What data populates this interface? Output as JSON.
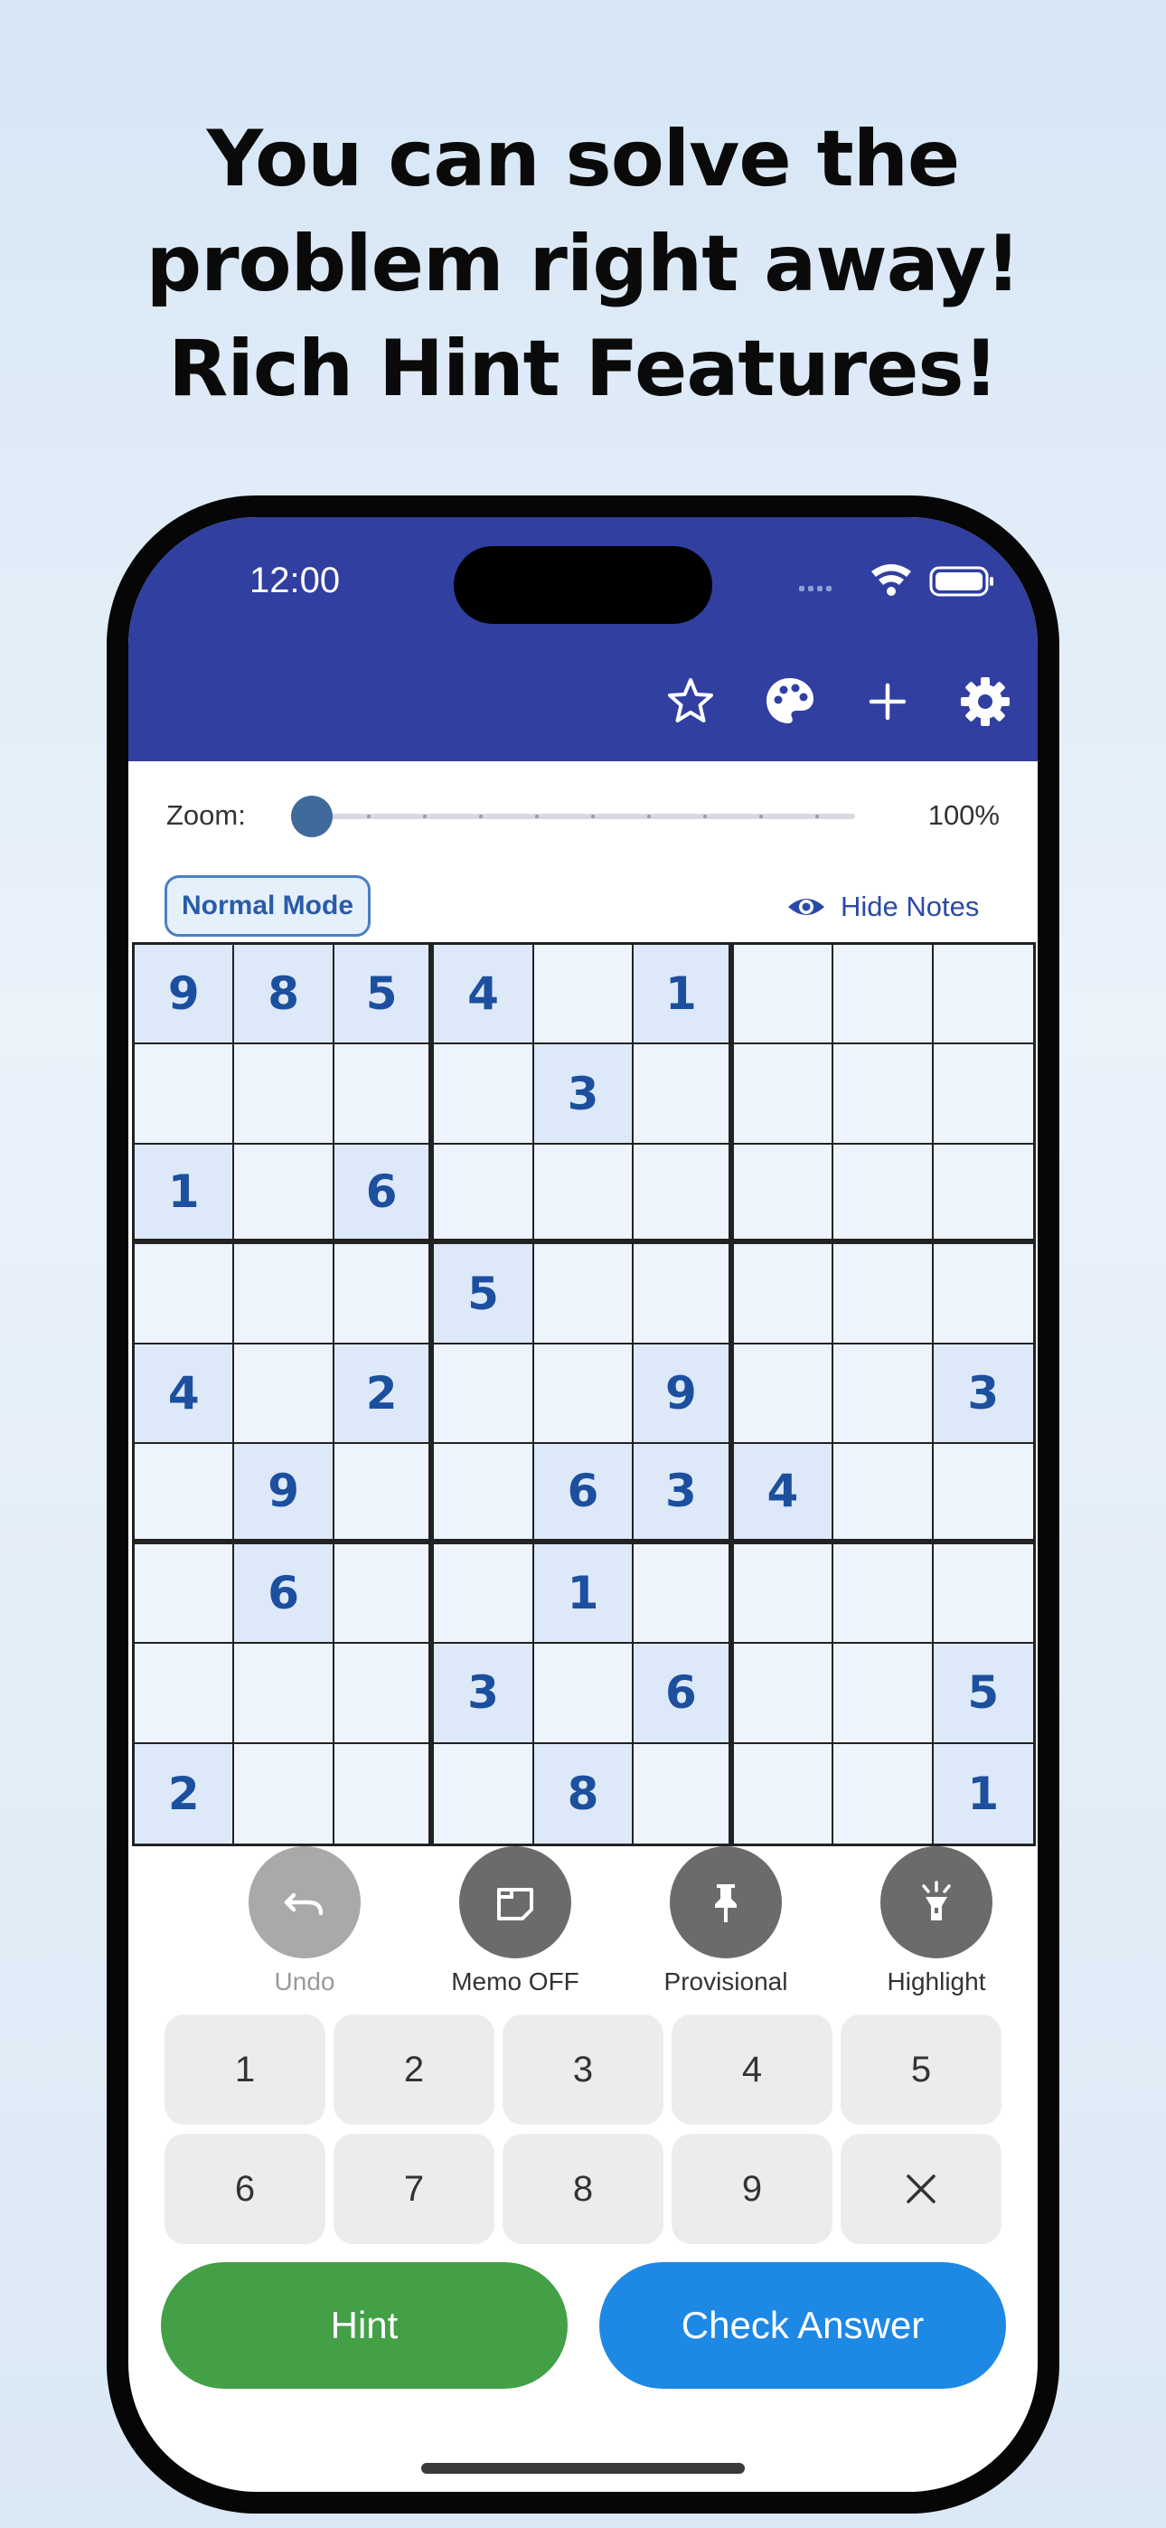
{
  "headline": {
    "line1": "You can solve the",
    "line2": "problem right away!",
    "line3": "Rich Hint Features!"
  },
  "status_bar": {
    "time": "12:00"
  },
  "toolbar": {
    "icons": [
      "star-outline-icon",
      "palette-icon",
      "plus-icon",
      "gear-icon"
    ]
  },
  "zoom": {
    "label": "Zoom:",
    "value_text": "100%",
    "level": 0.0
  },
  "mode": {
    "label": "Normal Mode"
  },
  "notes_toggle": {
    "label": "Hide Notes",
    "icon": "eye-icon"
  },
  "board": {
    "rows": [
      [
        "9",
        "8",
        "5",
        "4",
        "",
        "1",
        "",
        "",
        ""
      ],
      [
        "",
        "",
        "",
        "",
        "3",
        "",
        "",
        "",
        ""
      ],
      [
        "1",
        "",
        "6",
        "",
        "",
        "",
        "",
        "",
        ""
      ],
      [
        "",
        "",
        "",
        "5",
        "",
        "",
        "",
        "",
        ""
      ],
      [
        "4",
        "",
        "2",
        "",
        "",
        "9",
        "",
        "",
        "3"
      ],
      [
        "",
        "9",
        "",
        "",
        "6",
        "3",
        "4",
        "",
        ""
      ],
      [
        "",
        "6",
        "",
        "",
        "1",
        "",
        "",
        "",
        ""
      ],
      [
        "",
        "",
        "",
        "3",
        "",
        "6",
        "",
        "",
        "5"
      ],
      [
        "2",
        "",
        "",
        "",
        "8",
        "",
        "",
        "",
        "1"
      ]
    ]
  },
  "actions": {
    "undo": "Undo",
    "memo": "Memo OFF",
    "provisional": "Provisional",
    "highlight": "Highlight"
  },
  "keypad": {
    "keys": [
      "1",
      "2",
      "3",
      "4",
      "5",
      "6",
      "7",
      "8",
      "9"
    ],
    "erase_icon": "close-icon"
  },
  "buttons": {
    "hint": "Hint",
    "check": "Check Answer"
  },
  "colors": {
    "appbar": "#303fa0",
    "hint": "#43a047",
    "check": "#1e88e5",
    "digit": "#1c4f9e"
  }
}
